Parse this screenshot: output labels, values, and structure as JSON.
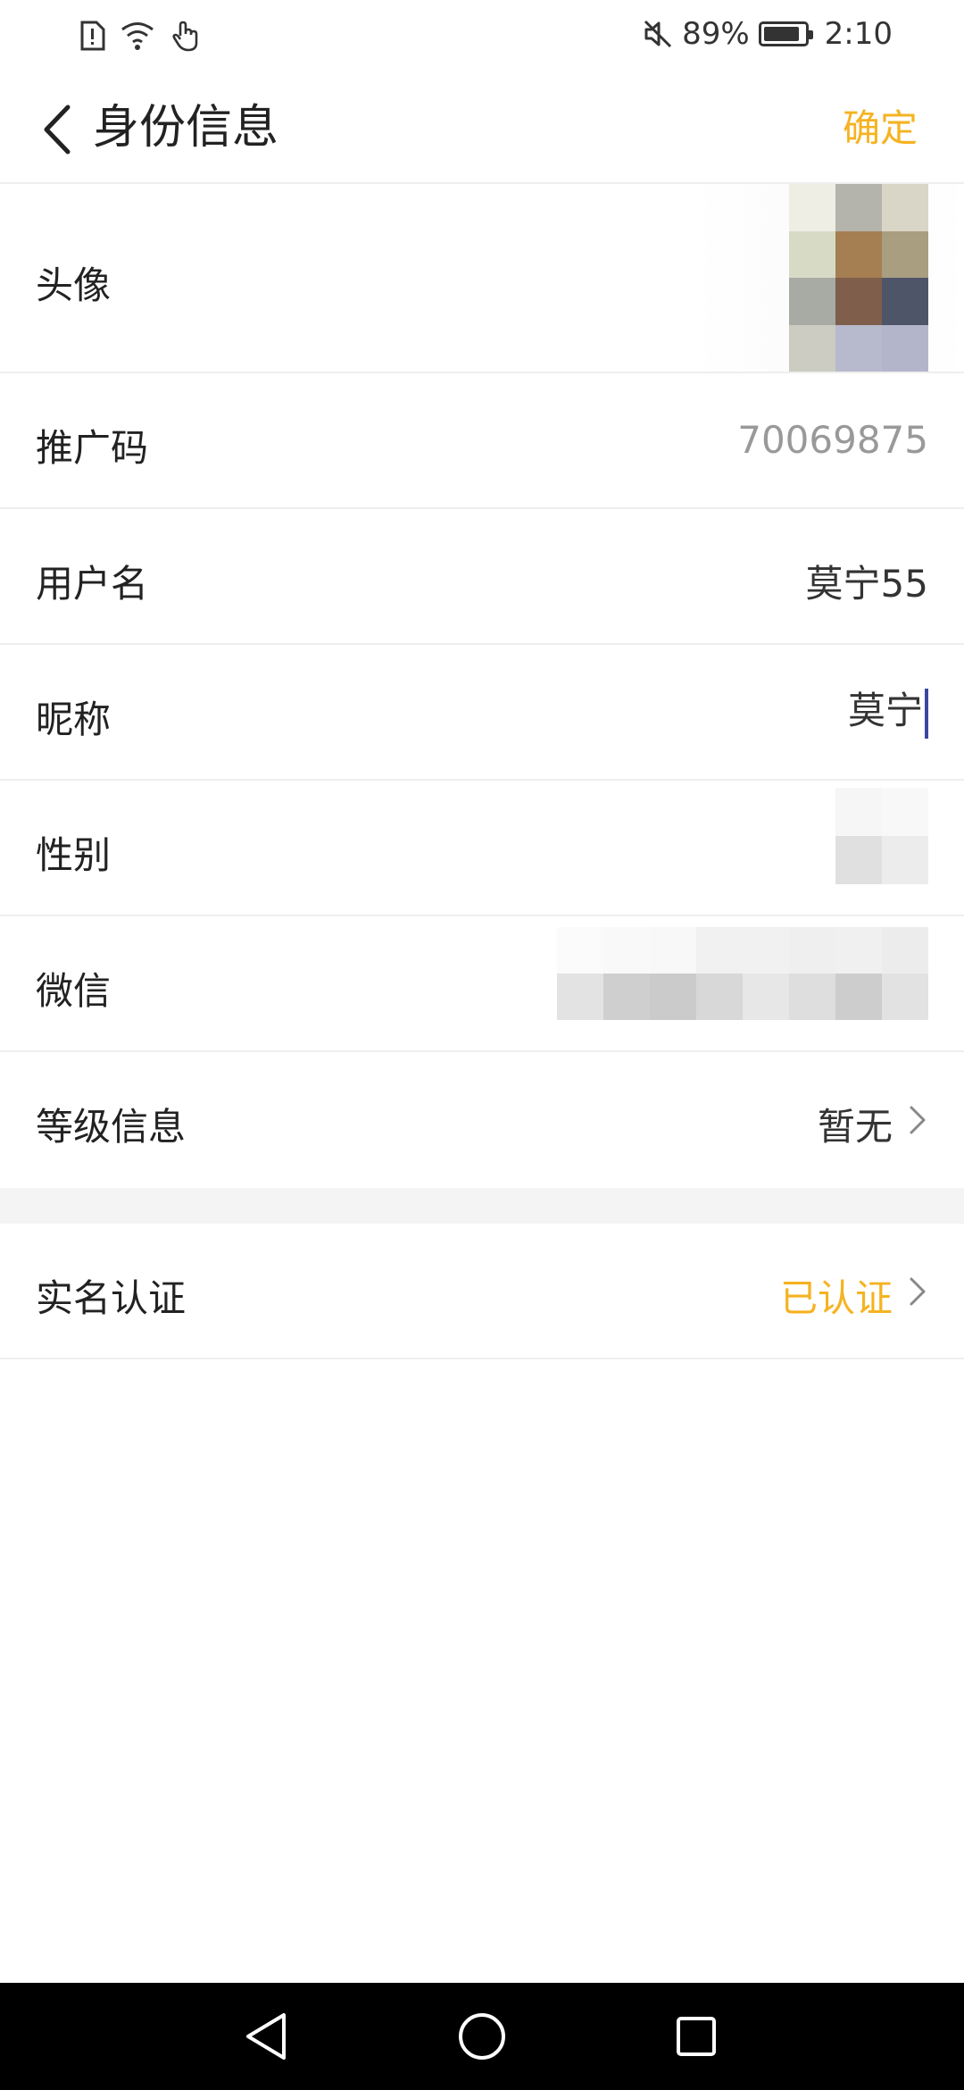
{
  "status_bar": {
    "battery_percent": "89%",
    "battery_level": 0.89,
    "time": "2:10",
    "icons": [
      "sim-alert-icon",
      "wifi-icon",
      "touch-icon",
      "mute-icon",
      "battery-icon"
    ]
  },
  "header": {
    "back_icon": "chevron-left-icon",
    "title": "身份信息",
    "confirm": "确定"
  },
  "rows": {
    "avatar": {
      "label": "头像"
    },
    "promo_code": {
      "label": "推广码",
      "value": "70069875"
    },
    "username": {
      "label": "用户名",
      "value": "莫宁55"
    },
    "nickname": {
      "label": "昵称",
      "value": "莫宁"
    },
    "gender": {
      "label": "性别"
    },
    "wechat": {
      "label": "微信"
    },
    "level": {
      "label": "等级信息",
      "value": "暂无"
    },
    "real_name": {
      "label": "实名认证",
      "value": "已认证"
    }
  },
  "nav_bar": {
    "icons": [
      "back-triangle-icon",
      "home-circle-icon",
      "recents-square-icon"
    ]
  },
  "colors": {
    "accent": "#F5B321",
    "text": "#222222",
    "muted": "#999999",
    "divider": "#EEEEEE",
    "section_bg": "#F4F4F4",
    "nav_bg": "#000000",
    "cursor": "#3A48A0"
  }
}
